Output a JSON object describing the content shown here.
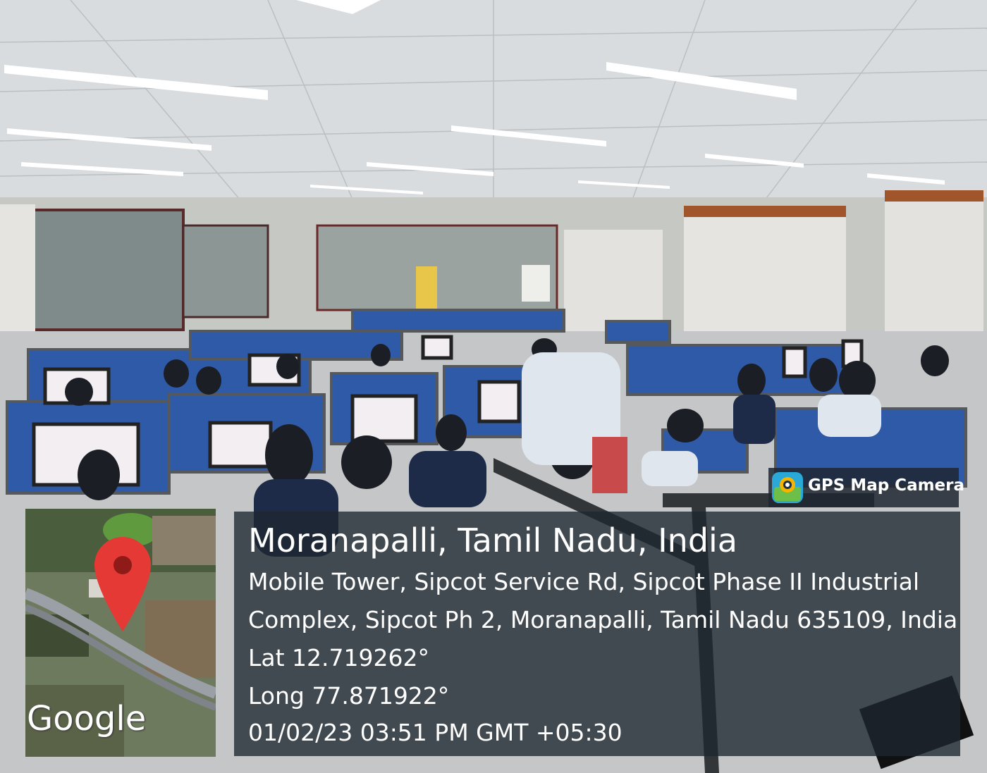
{
  "badge": {
    "label": "GPS Map Camera",
    "icon": "gps-map-camera-icon"
  },
  "map": {
    "logo_text": "Google",
    "icon": "location-pin-icon"
  },
  "location": {
    "title": "Moranapalli, Tamil Nadu, India",
    "address_line_1": "Mobile Tower, Sipcot Service Rd, Sipcot Phase II Industrial",
    "address_line_2": "Complex, Sipcot Ph 2, Moranapalli, Tamil Nadu 635109, India",
    "latitude": "Lat 12.719262°",
    "longitude": "Long 77.871922°",
    "timestamp": "01/02/23 03:51 PM GMT +05:30"
  },
  "colors": {
    "overlay": "#1e2630",
    "pin": "#e53935",
    "cubicle_blue": "#2f5aa8"
  }
}
